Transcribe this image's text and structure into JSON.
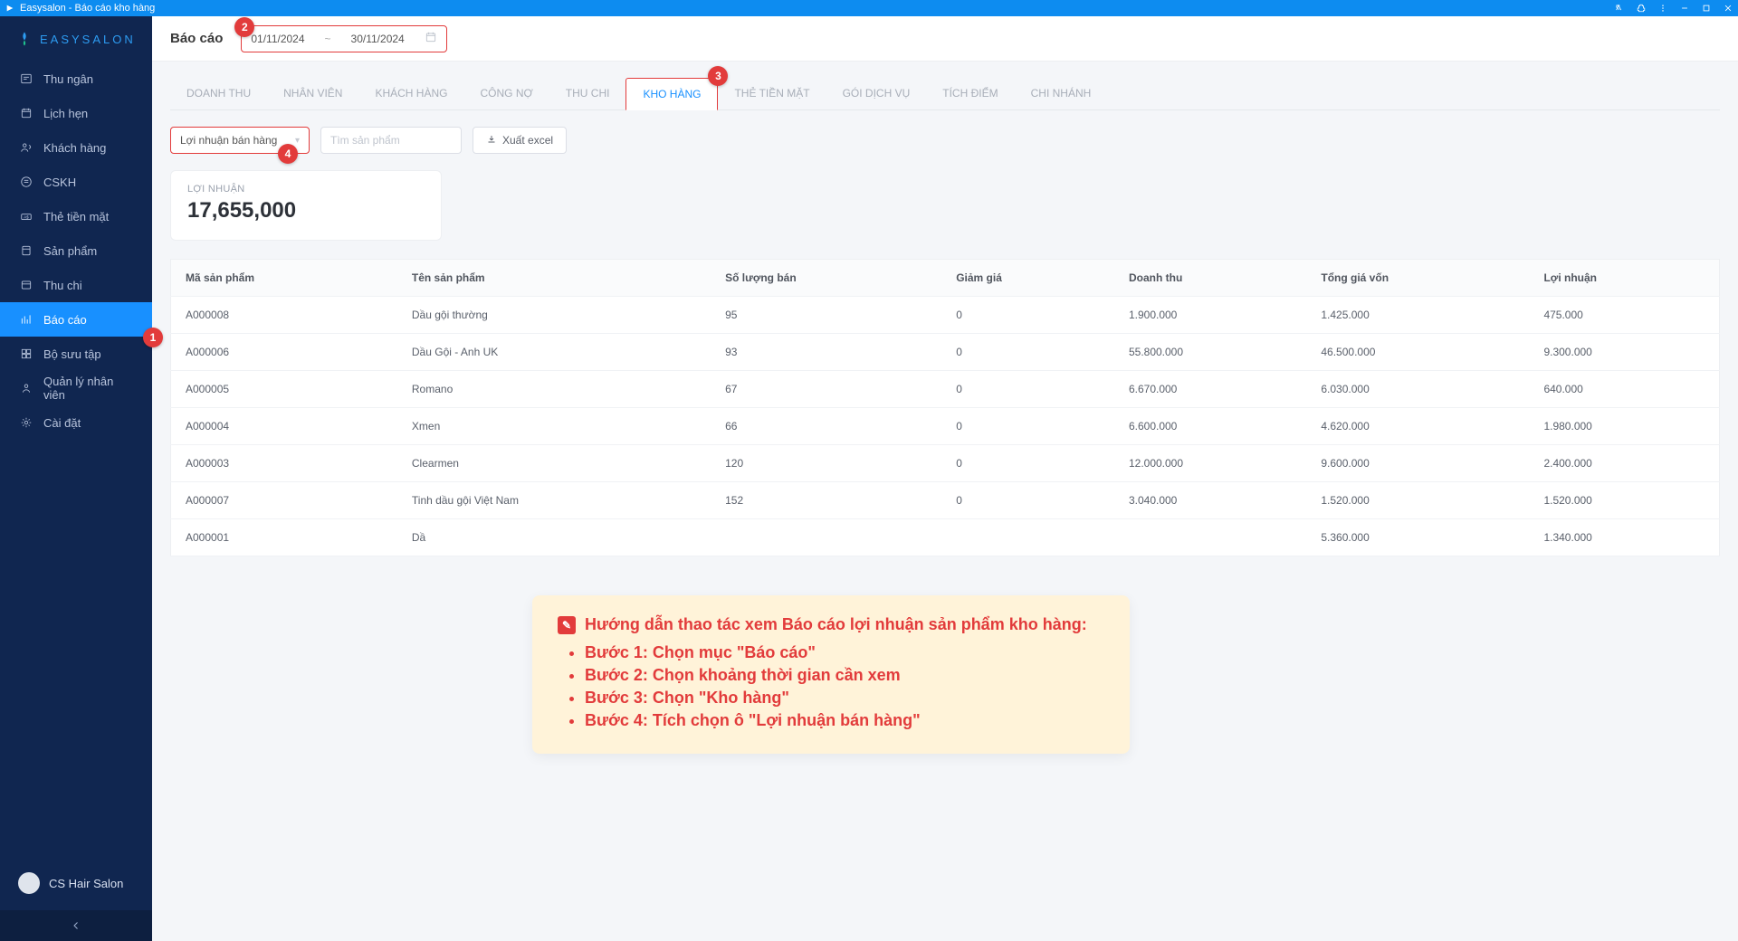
{
  "window": {
    "title": "Easysalon - Báo cáo kho hàng"
  },
  "brand": "EASYSALON",
  "sidebar": {
    "items": [
      {
        "label": "Thu ngân"
      },
      {
        "label": "Lịch hẹn"
      },
      {
        "label": "Khách hàng"
      },
      {
        "label": "CSKH"
      },
      {
        "label": "Thẻ tiền mặt"
      },
      {
        "label": "Sản phẩm"
      },
      {
        "label": "Thu chi"
      },
      {
        "label": "Báo cáo"
      },
      {
        "label": "Bộ sưu tập"
      },
      {
        "label": "Quản lý nhân viên"
      },
      {
        "label": "Cài đặt"
      }
    ],
    "active_index": 7
  },
  "user": {
    "name": "CS Hair Salon"
  },
  "header": {
    "title": "Báo cáo",
    "date_start": "01/11/2024",
    "date_sep": "~",
    "date_end": "30/11/2024"
  },
  "tabs": {
    "items": [
      "DOANH THU",
      "NHÂN VIÊN",
      "KHÁCH HÀNG",
      "CÔNG NỢ",
      "THU CHI",
      "KHO HÀNG",
      "THẺ TIỀN MẶT",
      "GÓI DỊCH VỤ",
      "TÍCH ĐIỂM",
      "CHI NHÁNH"
    ],
    "active_index": 5
  },
  "toolbar": {
    "select_value": "Lợi nhuận bán hàng",
    "search_placeholder": "Tìm sản phẩm",
    "export_label": "Xuất excel"
  },
  "stat": {
    "label": "LỢI NHUẬN",
    "value": "17,655,000"
  },
  "table": {
    "headers": [
      "Mã sản phẩm",
      "Tên sản phẩm",
      "Số lượng bán",
      "Giảm giá",
      "Doanh thu",
      "Tổng giá vốn",
      "Lợi nhuận"
    ],
    "rows": [
      [
        "A000008",
        "Dầu gội thường",
        "95",
        "0",
        "1.900.000",
        "1.425.000",
        "475.000"
      ],
      [
        "A000006",
        "Dầu Gội - Anh UK",
        "93",
        "0",
        "55.800.000",
        "46.500.000",
        "9.300.000"
      ],
      [
        "A000005",
        "Romano",
        "67",
        "0",
        "6.670.000",
        "6.030.000",
        "640.000"
      ],
      [
        "A000004",
        "Xmen",
        "66",
        "0",
        "6.600.000",
        "4.620.000",
        "1.980.000"
      ],
      [
        "A000003",
        "Clearmen",
        "120",
        "0",
        "12.000.000",
        "9.600.000",
        "2.400.000"
      ],
      [
        "A000007",
        "Tinh dầu gội Việt Nam",
        "152",
        "0",
        "3.040.000",
        "1.520.000",
        "1.520.000"
      ],
      [
        "A000001",
        "Dầ",
        "",
        "",
        "",
        "5.360.000",
        "1.340.000"
      ]
    ]
  },
  "markers": {
    "m1": "1",
    "m2": "2",
    "m3": "3",
    "m4": "4"
  },
  "callout": {
    "title": "Hướng dẫn thao tác xem Báo cáo lợi nhuận sản phẩm kho hàng:",
    "steps": [
      "Bước 1: Chọn mục \"Báo cáo\"",
      "Bước 2: Chọn khoảng thời gian cần xem",
      "Bước 3: Chọn \"Kho hàng\"",
      "Bước 4: Tích chọn ô \"Lợi nhuận bán hàng\""
    ]
  }
}
